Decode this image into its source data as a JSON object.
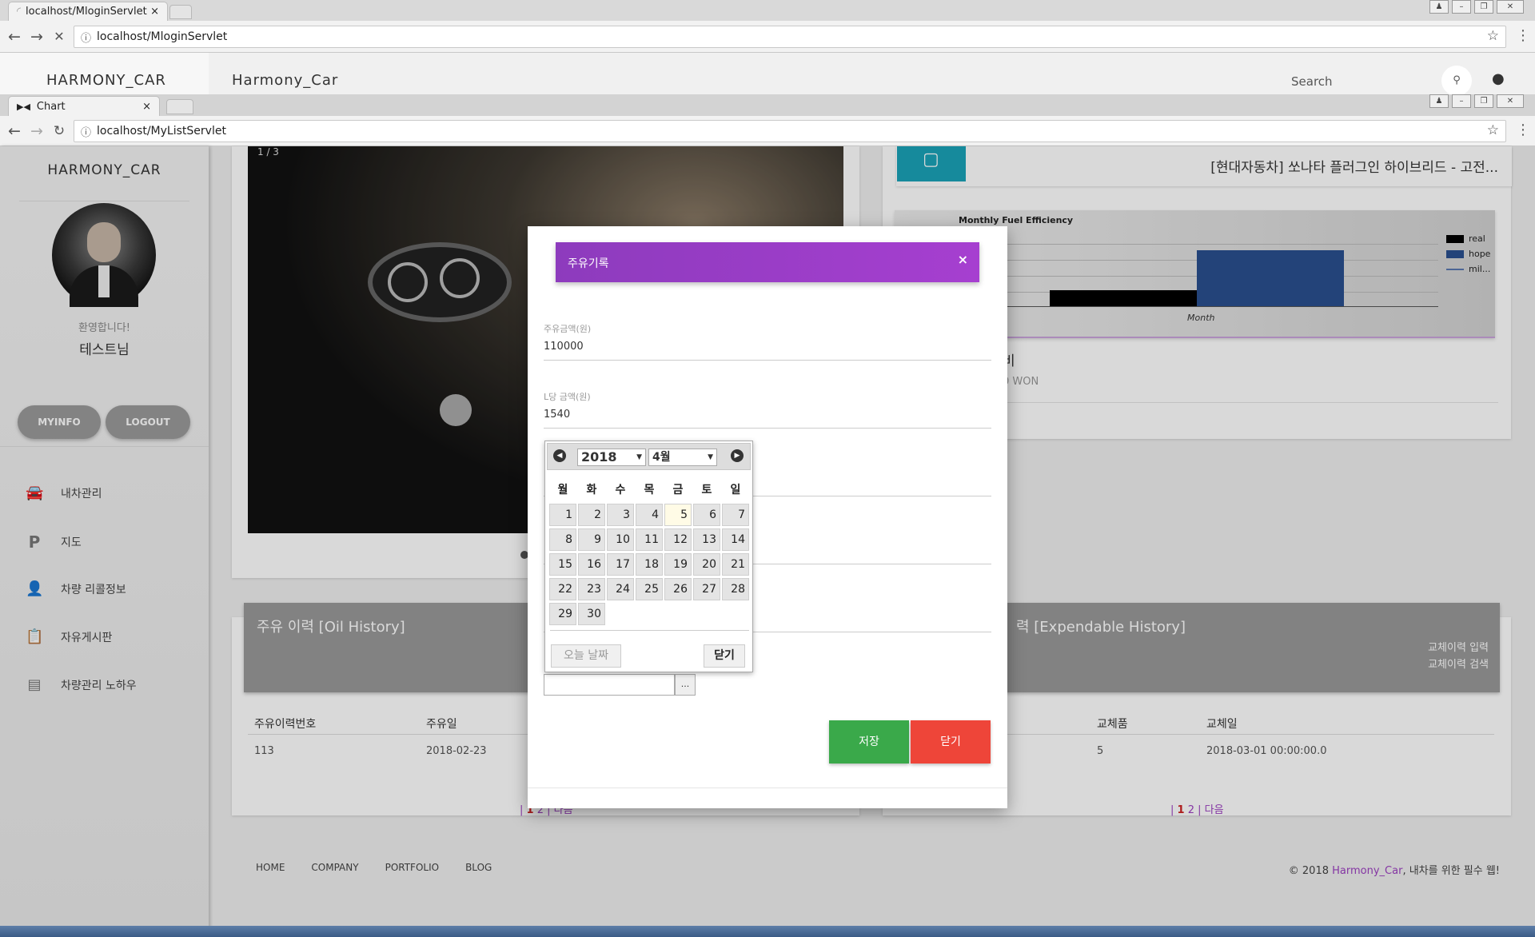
{
  "browser_back": {
    "tab_title": "localhost/MloginServlet",
    "url": "localhost/MloginServlet"
  },
  "header_back": {
    "brand": "HARMONY_CAR",
    "site_title": "Harmony_Car",
    "search_placeholder": "Search"
  },
  "browser_front": {
    "tab_title": "Chart",
    "url": "localhost/MyListServlet"
  },
  "sidebar": {
    "brand": "HARMONY_CAR",
    "welcome": "환영합니다!",
    "user": "테스트님",
    "myinfo": "MYINFO",
    "logout": "LOGOUT",
    "items": [
      {
        "label": "내차관리",
        "icon": "car-icon"
      },
      {
        "label": "지도",
        "icon": "parking-icon"
      },
      {
        "label": "차량 리콜정보",
        "icon": "person-icon"
      },
      {
        "label": "자유게시판",
        "icon": "clipboard-icon"
      },
      {
        "label": "차량관리 노하우",
        "icon": "library-icon"
      }
    ]
  },
  "slider": {
    "counter": "1 / 3"
  },
  "news": {
    "title": "[현대자동차] 쏘나타 플러그인 하이브리드 - 고전..."
  },
  "chart_data": {
    "type": "bar",
    "title": "Monthly Fuel Efficiency",
    "xlabel": "Month",
    "series": [
      {
        "name": "real",
        "color": "#000000"
      },
      {
        "name": "hope",
        "color": "#2a4f8f"
      },
      {
        "name": "mil...",
        "color": "#5a78b0"
      }
    ],
    "legend": "right"
  },
  "fuel_cost_card": {
    "label_partial": "비",
    "value_partial": "0 WON"
  },
  "oil_history": {
    "title": "주유 이력 [Oil History]",
    "headers": [
      "주유이력번호",
      "주유일"
    ],
    "rows": [
      [
        "113",
        "2018-02-23"
      ]
    ],
    "pager": [
      "1",
      "2",
      "다음"
    ]
  },
  "exp_history": {
    "title_partial": "력 [Expendable History]",
    "link_input": "교체이력 입력",
    "link_search": "교체이력 검색",
    "headers": [
      "교체품",
      "교체일"
    ],
    "rows": [
      [
        "5",
        "2018-03-01 00:00:00.0"
      ]
    ],
    "pager": [
      "1",
      "2",
      "다음"
    ]
  },
  "footer": {
    "links": [
      "HOME",
      "COMPANY",
      "PORTFOLIO",
      "BLOG"
    ],
    "copyright_prefix": "© 2018 ",
    "copyright_brand": "Harmony_Car",
    "copyright_suffix": ", 내차를 위한 필수 웹!"
  },
  "modal": {
    "title": "주유기록",
    "close_x": "×",
    "f1_label": "주유금액(원)",
    "f1_value": "110000",
    "f2_label": "L당 금액(원)",
    "f2_value": "1540",
    "date_btn": "...",
    "save": "저장",
    "close": "닫기",
    "save_color": "#3aa94a",
    "close_color": "#ee4539",
    "header_color": "#9c3fc0"
  },
  "calendar": {
    "year": "2018",
    "month": "4월",
    "weekdays": [
      "월",
      "화",
      "수",
      "목",
      "금",
      "토",
      "일"
    ],
    "today_label": "오늘 날짜",
    "close_label": "닫기"
  }
}
